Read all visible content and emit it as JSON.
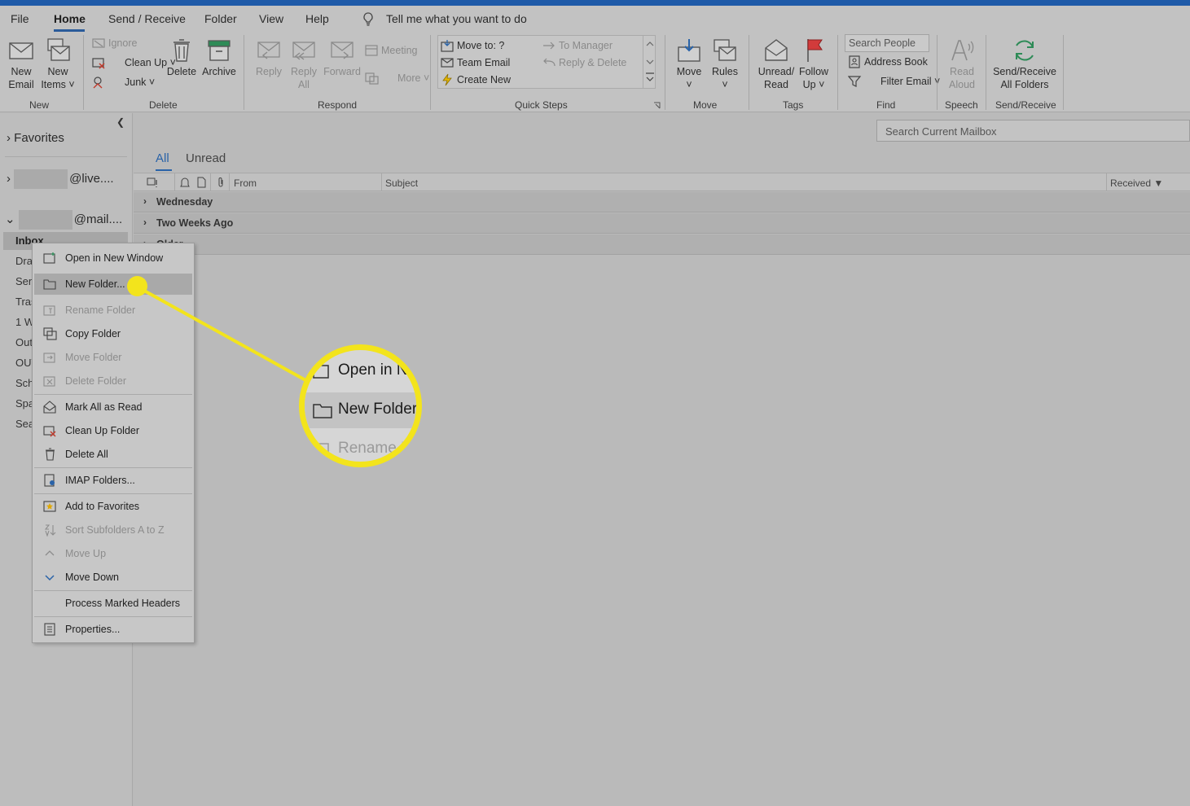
{
  "menu": {
    "tabs": [
      "File",
      "Home",
      "Send / Receive",
      "Folder",
      "View",
      "Help"
    ],
    "active_tab": "Home",
    "tell_me": "Tell me what you want to do"
  },
  "ribbon": {
    "new": {
      "new_email": [
        "New",
        "Email"
      ],
      "new_items": [
        "New",
        "Items"
      ],
      "label": "New"
    },
    "delete": {
      "ignore": "Ignore",
      "clean_up": "Clean Up",
      "junk": "Junk",
      "delete": "Delete",
      "archive": "Archive",
      "label": "Delete"
    },
    "respond": {
      "reply": "Reply",
      "reply_all": [
        "Reply",
        "All"
      ],
      "forward": "Forward",
      "meeting": "Meeting",
      "more": "More",
      "label": "Respond"
    },
    "quick_steps": {
      "move_to": "Move to: ?",
      "team_email": "Team Email",
      "create_new": "Create New",
      "to_manager": "To Manager",
      "reply_delete": "Reply & Delete",
      "label": "Quick Steps"
    },
    "move": {
      "move": "Move",
      "rules": "Rules",
      "label": "Move"
    },
    "tags": {
      "unread_read": [
        "Unread/",
        "Read"
      ],
      "follow_up": [
        "Follow",
        "Up"
      ],
      "label": "Tags"
    },
    "find": {
      "search_people": "Search People",
      "address_book": "Address Book",
      "filter_email": "Filter Email",
      "label": "Find"
    },
    "speech": {
      "read_aloud": [
        "Read",
        "Aloud"
      ],
      "label": "Speech"
    },
    "send_receive": {
      "all_folders": [
        "Send/Receive",
        "All Folders"
      ],
      "label": "Send/Receive"
    }
  },
  "sidebar": {
    "favorites": "Favorites",
    "accounts": [
      "@live....",
      "@mail...."
    ],
    "inbox": "Inbox",
    "folder_stubs": [
      "Draf",
      "Sen",
      "Tras",
      "1 W",
      "Out",
      "OUT",
      "Sch",
      "Spa",
      "Sea"
    ]
  },
  "content": {
    "search_placeholder": "Search Current Mailbox",
    "filters": [
      "All",
      "Unread"
    ],
    "columns": {
      "from": "From",
      "subject": "Subject",
      "received": "Received"
    },
    "groups": [
      "Wednesday",
      "Two Weeks Ago",
      "Older"
    ]
  },
  "context_menu": {
    "items": [
      {
        "label": "Open in New Window",
        "enabled": true
      },
      {
        "label": "New Folder...",
        "enabled": true,
        "highlighted": true
      },
      {
        "label": "Rename Folder",
        "enabled": false
      },
      {
        "label": "Copy Folder",
        "enabled": true
      },
      {
        "label": "Move Folder",
        "enabled": false
      },
      {
        "label": "Delete Folder",
        "enabled": false
      },
      {
        "label": "Mark All as Read",
        "enabled": true
      },
      {
        "label": "Clean Up Folder",
        "enabled": true
      },
      {
        "label": "Delete All",
        "enabled": true
      },
      {
        "label": "IMAP Folders...",
        "enabled": true
      },
      {
        "label": "Add to Favorites",
        "enabled": true
      },
      {
        "label": "Sort Subfolders A to Z",
        "enabled": false
      },
      {
        "label": "Move Up",
        "enabled": false
      },
      {
        "label": "Move Down",
        "enabled": true
      },
      {
        "label": "Process Marked Headers",
        "enabled": true
      },
      {
        "label": "Properties...",
        "enabled": true
      }
    ]
  },
  "magnifier": {
    "rows": [
      "Open in N",
      "New Folder.",
      "Rename F"
    ]
  },
  "colors": {
    "callout": "#f3e41c",
    "accent": "#2a63a8",
    "title_bar": "#1e5aa8"
  }
}
